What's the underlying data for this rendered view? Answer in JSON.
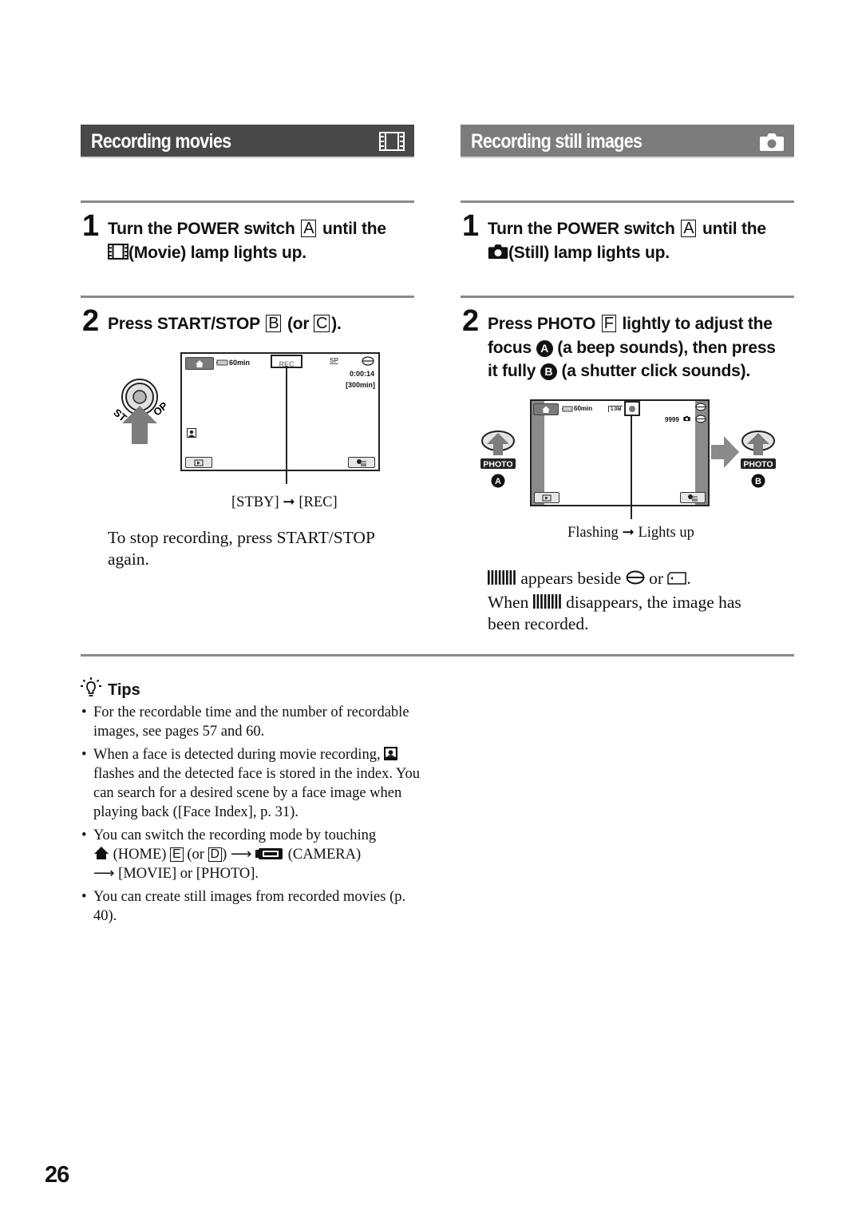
{
  "page_number": "26",
  "sections": {
    "movies": {
      "header": "Recording movies",
      "header_icon": "film-icon",
      "step1": {
        "number": "1",
        "line1_before": "Turn the POWER switch",
        "line1_key": "A",
        "line1_after": "until the",
        "line2_icon": "film-icon",
        "line2": "(Movie) lamp lights up."
      },
      "step2": {
        "number": "2",
        "before": "Press START/STOP",
        "key1": "B",
        "mid": "(or",
        "key2": "C",
        "after": ")."
      },
      "screen": {
        "battery": "60min",
        "rec_label": "REC",
        "quality": "SP",
        "media_icon": "hdd-icon",
        "time": "0:00:14",
        "remaining": "[300min]"
      },
      "button_label_left": "ST",
      "button_label_right": "OP",
      "caption": "[STBY] ➞ [REC]",
      "stop_note": "To stop recording, press START/STOP again."
    },
    "still": {
      "header": "Recording still images",
      "header_icon": "camera-icon",
      "step1": {
        "number": "1",
        "line1_before": "Turn the POWER switch",
        "line1_key": "A",
        "line1_after": "until the",
        "line2_icon": "camera-icon",
        "line2": "(Still) lamp lights up."
      },
      "step2": {
        "number": "2",
        "line1_before": "Press PHOTO",
        "line1_key": "F",
        "line1_after": "lightly to adjust the",
        "line2_before": "focus",
        "marker_a": "A",
        "line2_after": "(a beep sounds), then press",
        "line3_before": "it fully",
        "marker_b": "B",
        "line3_after": "(a shutter click sounds)."
      },
      "screen": {
        "battery": "60min",
        "image_size": "1.0M",
        "count": "9999"
      },
      "photo_label": "PHOTO",
      "label_a": "A",
      "label_b": "B",
      "caption": "Flashing ➞ Lights up",
      "note1_after_icon": "appears beside",
      "note1_or": "or",
      "note2_before": "When",
      "note2_after": "disappears, the image has",
      "note2_line2": "been recorded."
    }
  },
  "tips": {
    "title": "Tips",
    "items": [
      {
        "text": "For the recordable time and the number of recordable images, see pages 57 and 60."
      },
      {
        "before": "When a face is detected during movie recording,",
        "after": "flashes and the detected face is stored in the index. You can search for a desired scene by a face image when playing back ([Face Index], p. 31)."
      },
      {
        "line1": "You can switch the recording mode by touching",
        "home": "(HOME)",
        "key_e": "E",
        "or": "(or",
        "key_d": "D",
        "close": ")",
        "camera": "(CAMERA)",
        "line3": "[MOVIE] or [PHOTO]."
      },
      {
        "text": "You can create still images from recorded movies (p. 40)."
      }
    ]
  }
}
